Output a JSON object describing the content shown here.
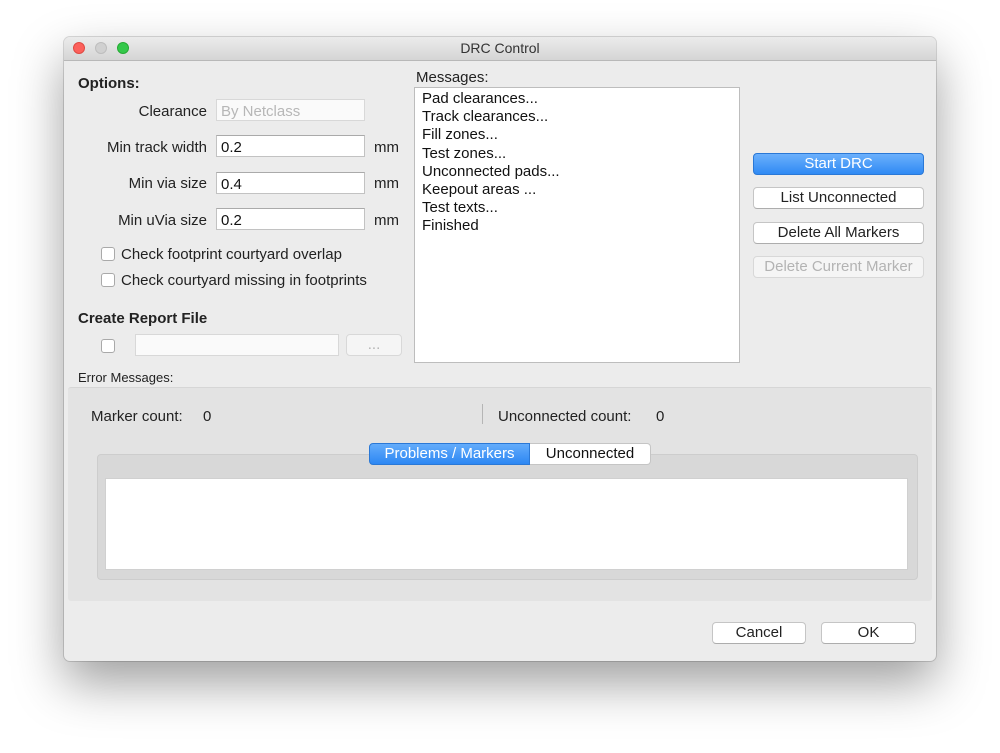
{
  "window": {
    "title": "DRC Control"
  },
  "options": {
    "heading": "Options:",
    "clearance": {
      "label": "Clearance",
      "placeholder": "By Netclass"
    },
    "min_track_width": {
      "label": "Min track width",
      "value": "0.2",
      "unit": "mm"
    },
    "min_via_size": {
      "label": "Min via size",
      "value": "0.4",
      "unit": "mm"
    },
    "min_uvia_size": {
      "label": "Min uVia size",
      "value": "0.2",
      "unit": "mm"
    },
    "check_courtyard_overlap": {
      "label": "Check footprint courtyard overlap",
      "checked": false
    },
    "check_courtyard_missing": {
      "label": "Check courtyard missing in footprints",
      "checked": false
    }
  },
  "report": {
    "heading": "Create Report File",
    "path_value": "",
    "browse_label": "..."
  },
  "messages": {
    "label": "Messages:",
    "lines": [
      "Pad clearances...",
      "Track clearances...",
      "Fill zones...",
      "Test zones...",
      "Unconnected pads...",
      "Keepout areas ...",
      "Test texts...",
      "Finished"
    ]
  },
  "actions": {
    "start_drc": "Start DRC",
    "list_unconnected": "List Unconnected",
    "delete_all_markers": "Delete All Markers",
    "delete_current_marker": "Delete Current Marker"
  },
  "errors": {
    "label": "Error Messages:",
    "marker_count_label": "Marker count:",
    "marker_count": "0",
    "unconnected_count_label": "Unconnected count:",
    "unconnected_count": "0",
    "tabs": [
      {
        "label": "Problems / Markers",
        "active": true
      },
      {
        "label": "Unconnected",
        "active": false
      }
    ]
  },
  "footer": {
    "cancel": "Cancel",
    "ok": "OK"
  },
  "colors": {
    "accent": "#2f8af4",
    "close": "#fc605b",
    "zoom": "#34c84a"
  }
}
